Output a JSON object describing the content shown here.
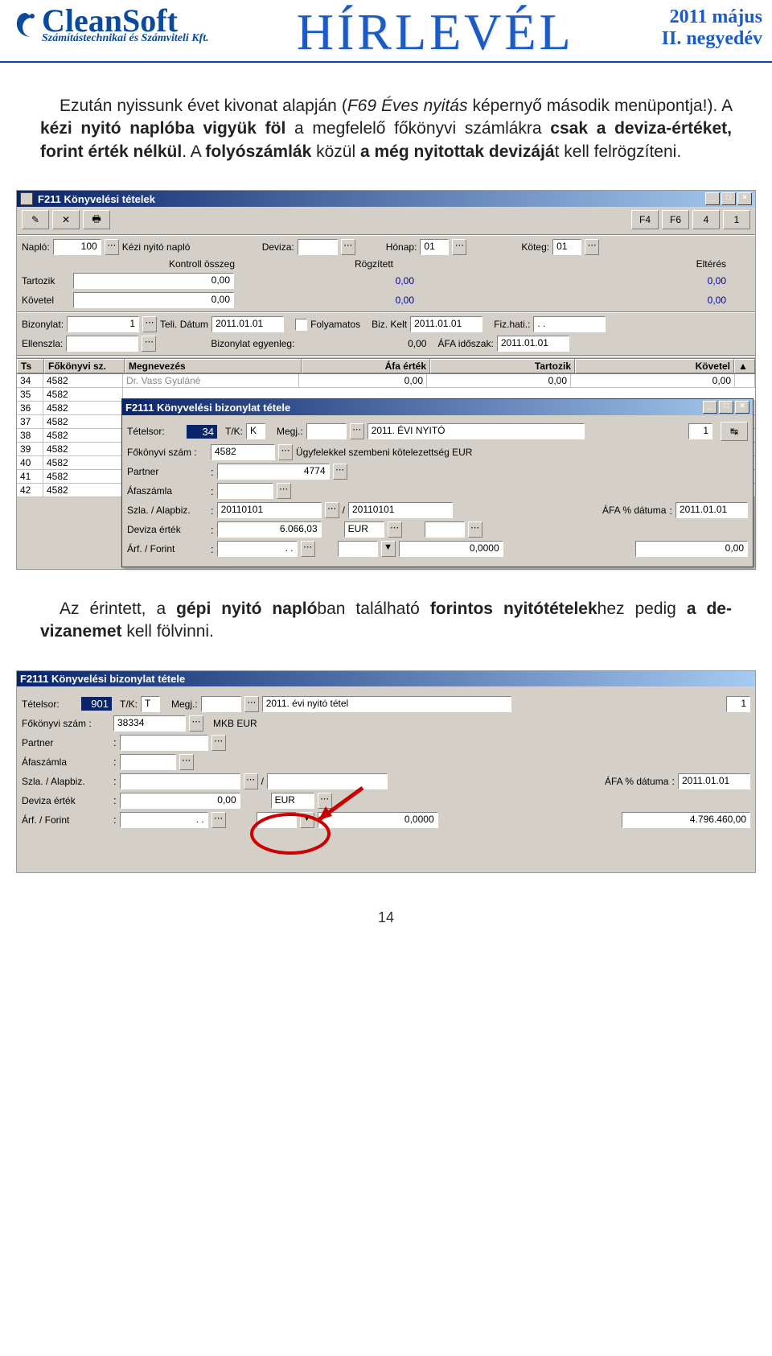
{
  "header": {
    "brand": "CleanSoft",
    "brand_sub": "Számítástechnikai és Számviteli Kft.",
    "title": "HÍRLEVÉL",
    "date_line1": "2011 május",
    "date_line2": "II. negyedév"
  },
  "para1_a": "Ezután nyissunk évet kivonat alapján (",
  "para1_i": "F69 Éves nyitás",
  "para1_b": " képernyő második menüpontja!). A ",
  "para1_bold1": "kézi nyitó naplóba vigyük föl",
  "para1_c": " a megfelelő főkönyvi számlákra ",
  "para1_bold2": "csak a deviza-értéket, forint érték nélkül",
  "para1_d": ". A ",
  "para1_bold3": "folyószámlák",
  "para1_e": " közül ",
  "para1_bold4": "a még nyitottak devizájá",
  "para1_f": "t kell felrögzíteni.",
  "win1": {
    "title": "F211 Könyvelési tételek",
    "tb": {
      "f4": "F4",
      "f6": "F6",
      "b4": "4",
      "b1": "1"
    },
    "lbl_naplo": "Napló:",
    "naplo_code": "100",
    "naplo_name": "Kézi nyitó napló",
    "lbl_deviza": "Deviza:",
    "lbl_honap": "Hónap:",
    "honap_val": "01",
    "lbl_koteg": "Köteg:",
    "koteg_val": "01",
    "lbl_kontroll": "Kontroll összeg",
    "lbl_rogzitett": "Rögzített",
    "lbl_elteres": "Eltérés",
    "lbl_tartozik": "Tartozik",
    "lbl_kovetel": "Követel",
    "zero": "0,00",
    "lbl_bizonylat": "Bizonylat:",
    "bizonylat_val": "1",
    "lbl_teli": "Teli. Dátum",
    "teli_val": "2011.01.01",
    "lbl_folyamatos": "Folyamatos",
    "lbl_bizkelt": "Biz. Kelt",
    "lbl_fizhati": "Fiz.hati.:",
    "fizhati_val": ". .",
    "lbl_ellenszla": "Ellenszla:",
    "lbl_bizegyenleg": "Bizonylat egyenleg:",
    "bizegy_val": "0,00",
    "lbl_afaidoszak": "ÁFA időszak:",
    "afaidoszak_val": "2011.01.01",
    "cols": {
      "ts": "Ts",
      "fksz": "Főkönyvi sz.",
      "megn": "Megnevezés",
      "afa": "Áfa érték",
      "tart": "Tartozik",
      "kov": "Követel"
    },
    "rows": [
      {
        "ts": "34",
        "fksz": "4582",
        "megn": "Dr. Vass Gyuláné",
        "afa": "0,00",
        "tart": "0,00",
        "kov": "0,00"
      },
      {
        "ts": "35",
        "fksz": "4582"
      },
      {
        "ts": "36",
        "fksz": "4582"
      },
      {
        "ts": "37",
        "fksz": "4582"
      },
      {
        "ts": "38",
        "fksz": "4582"
      },
      {
        "ts": "39",
        "fksz": "4582"
      },
      {
        "ts": "40",
        "fksz": "4582"
      },
      {
        "ts": "41",
        "fksz": "4582"
      },
      {
        "ts": "42",
        "fksz": "4582"
      }
    ]
  },
  "win2": {
    "title": "F2111 Könyvelési bizonylat tétele",
    "lbl_tetelsor": "Tételsor:",
    "tetelsor_val": "34",
    "lbl_tk": "T/K:",
    "tk_val": "K",
    "lbl_megj": "Megj.:",
    "megj_desc": "2011. ÉVI NYITÓ",
    "seq": "1",
    "lbl_fksz": "Főkönyvi szám :",
    "fksz_val": "4582",
    "fksz_name": "Ügyfelekkel szembeni kötelezettség EUR",
    "lbl_partner": "Partner",
    "partner_val": "4774",
    "lbl_afaszamla": "Áfaszámla",
    "lbl_szla": "Szla. / Alapbiz.",
    "szla_a": "20110101",
    "szla_slash": "/",
    "szla_b": "20110101",
    "lbl_afadatum": "ÁFA % dátuma",
    "afadatum_val": "2011.01.01",
    "lbl_devertek": "Deviza érték",
    "devertek_val": "6.066,03",
    "dev_eur": "EUR",
    "lbl_arf": "Árf. / Forint",
    "arf_a": ". .",
    "arf_rate": "0,0000",
    "arf_forint": "0,00"
  },
  "para2_a": "Az érintett, a ",
  "para2_bold1": "gépi nyitó napló",
  "para2_b": "ban található ",
  "para2_bold2": "forintos nyitótételek",
  "para2_c": "hez pedig ",
  "para2_bold3": "a de-vizanemet",
  "para2_d": " kell fölvinni.",
  "win3": {
    "title": "F2111 Könyvelési bizonylat tétele",
    "lbl_tetelsor": "Tételsor:",
    "tetelsor_val": "901",
    "lbl_tk": "T/K:",
    "tk_val": "T",
    "lbl_megj": "Megj.:",
    "megj_desc": "2011. évi nyitó tétel",
    "seq": "1",
    "lbl_fksz": "Főkönyvi szám :",
    "fksz_val": "38334",
    "fksz_name": "MKB EUR",
    "lbl_partner": "Partner",
    "lbl_afaszamla": "Áfaszámla",
    "lbl_szla": "Szla. / Alapbiz.",
    "szla_slash": "/",
    "lbl_afadatum": "ÁFA % dátuma",
    "afadatum_val": "2011.01.01",
    "lbl_devertek": "Deviza érték",
    "devertek_val": "0,00",
    "dev_eur": "EUR",
    "lbl_arf": "Árf. / Forint",
    "arf_a": ". .",
    "arf_rate": "0,0000",
    "arf_forint": "4.796.460,00"
  },
  "page_num": "14"
}
